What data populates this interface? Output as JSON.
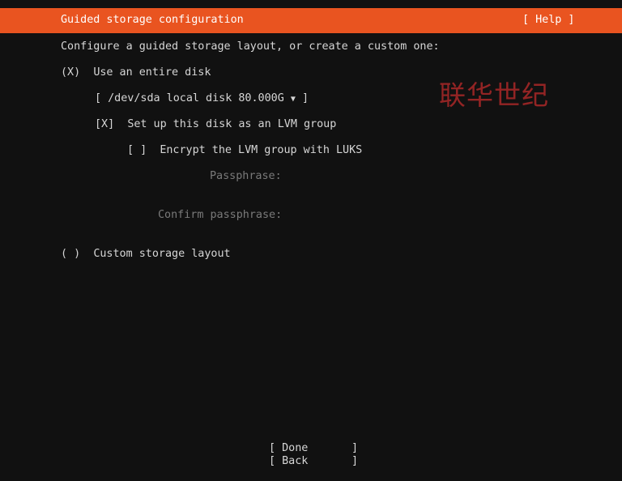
{
  "colors": {
    "accent": "#e95420",
    "background": "#111111",
    "text": "#d6d6d6",
    "dimmed_text": "#7a7a7a",
    "watermark": "#aa2828"
  },
  "header": {
    "title": "Guided storage configuration",
    "help": "[ Help ]"
  },
  "intro": "Configure a guided storage layout, or create a custom one:",
  "option_entire_disk": {
    "radio": "(X)",
    "label": "Use an entire disk"
  },
  "disk_select": {
    "open": "[",
    "value": "/dev/sda local disk 80.000G",
    "arrow": "▼",
    "close": "]"
  },
  "lvm": {
    "checkbox": "[X]",
    "label": "Set up this disk as an LVM group"
  },
  "encrypt": {
    "checkbox": "[ ]",
    "label": "Encrypt the LVM group with LUKS"
  },
  "passphrase_label": "Passphrase:",
  "confirm_passphrase_label": "Confirm passphrase:",
  "option_custom": {
    "radio": "( )",
    "label": "Custom storage layout"
  },
  "buttons": {
    "done": {
      "label": "Done",
      "open": "[",
      "close": "]"
    },
    "back": {
      "label": "Back",
      "open": "[",
      "close": "]"
    }
  },
  "watermark": "联华世纪"
}
